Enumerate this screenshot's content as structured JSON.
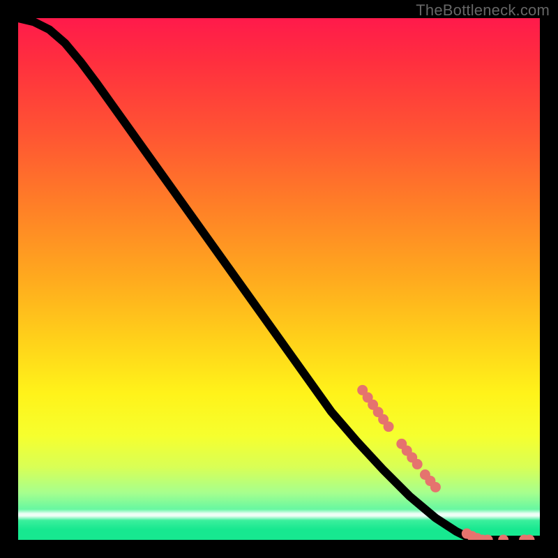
{
  "watermark": "TheBottleneck.com",
  "chart_data": {
    "type": "line",
    "title": "",
    "xlabel": "",
    "ylabel": "",
    "xlim": [
      0,
      100
    ],
    "ylim": [
      0,
      100
    ],
    "grid": false,
    "legend": false,
    "curve": [
      {
        "x": 0,
        "y": 100
      },
      {
        "x": 3,
        "y": 99.3
      },
      {
        "x": 6,
        "y": 97.8
      },
      {
        "x": 9,
        "y": 95.2
      },
      {
        "x": 12,
        "y": 91.6
      },
      {
        "x": 15,
        "y": 87.6
      },
      {
        "x": 18,
        "y": 83.4
      },
      {
        "x": 21,
        "y": 79.2
      },
      {
        "x": 25,
        "y": 73.6
      },
      {
        "x": 30,
        "y": 66.6
      },
      {
        "x": 35,
        "y": 59.6
      },
      {
        "x": 40,
        "y": 52.6
      },
      {
        "x": 45,
        "y": 45.6
      },
      {
        "x": 50,
        "y": 38.6
      },
      {
        "x": 55,
        "y": 31.6
      },
      {
        "x": 60,
        "y": 24.6
      },
      {
        "x": 65,
        "y": 18.8
      },
      {
        "x": 70,
        "y": 13.4
      },
      {
        "x": 75,
        "y": 8.4
      },
      {
        "x": 80,
        "y": 4.2
      },
      {
        "x": 84,
        "y": 1.6
      },
      {
        "x": 86,
        "y": 0.6
      },
      {
        "x": 88,
        "y": 0
      },
      {
        "x": 100,
        "y": 0
      }
    ],
    "markers": [
      {
        "x": 66,
        "y": 28.7
      },
      {
        "x": 67,
        "y": 27.3
      },
      {
        "x": 68,
        "y": 25.9
      },
      {
        "x": 69,
        "y": 24.5
      },
      {
        "x": 70,
        "y": 23.1
      },
      {
        "x": 71,
        "y": 21.7
      },
      {
        "x": 73.5,
        "y": 18.4
      },
      {
        "x": 74.5,
        "y": 17.1
      },
      {
        "x": 75.5,
        "y": 15.8
      },
      {
        "x": 76.5,
        "y": 14.5
      },
      {
        "x": 78,
        "y": 12.5
      },
      {
        "x": 79,
        "y": 11.3
      },
      {
        "x": 80,
        "y": 10.1
      },
      {
        "x": 86,
        "y": 1.2
      },
      {
        "x": 87,
        "y": 0.7
      },
      {
        "x": 88,
        "y": 0.3
      },
      {
        "x": 89,
        "y": 0
      },
      {
        "x": 90,
        "y": 0
      },
      {
        "x": 93,
        "y": 0
      },
      {
        "x": 97,
        "y": 0
      },
      {
        "x": 98,
        "y": 0
      }
    ],
    "marker_radius_pct": 1.0,
    "colors": {
      "curve": "#000000",
      "marker": "#e5736e",
      "gradient_stops": [
        {
          "pos": 0,
          "color": "#ff1a4b"
        },
        {
          "pos": 22,
          "color": "#ff5433"
        },
        {
          "pos": 50,
          "color": "#ffaa1e"
        },
        {
          "pos": 72,
          "color": "#fff31a"
        },
        {
          "pos": 91,
          "color": "#a6ff8e"
        },
        {
          "pos": 100,
          "color": "#17e890"
        }
      ]
    }
  }
}
